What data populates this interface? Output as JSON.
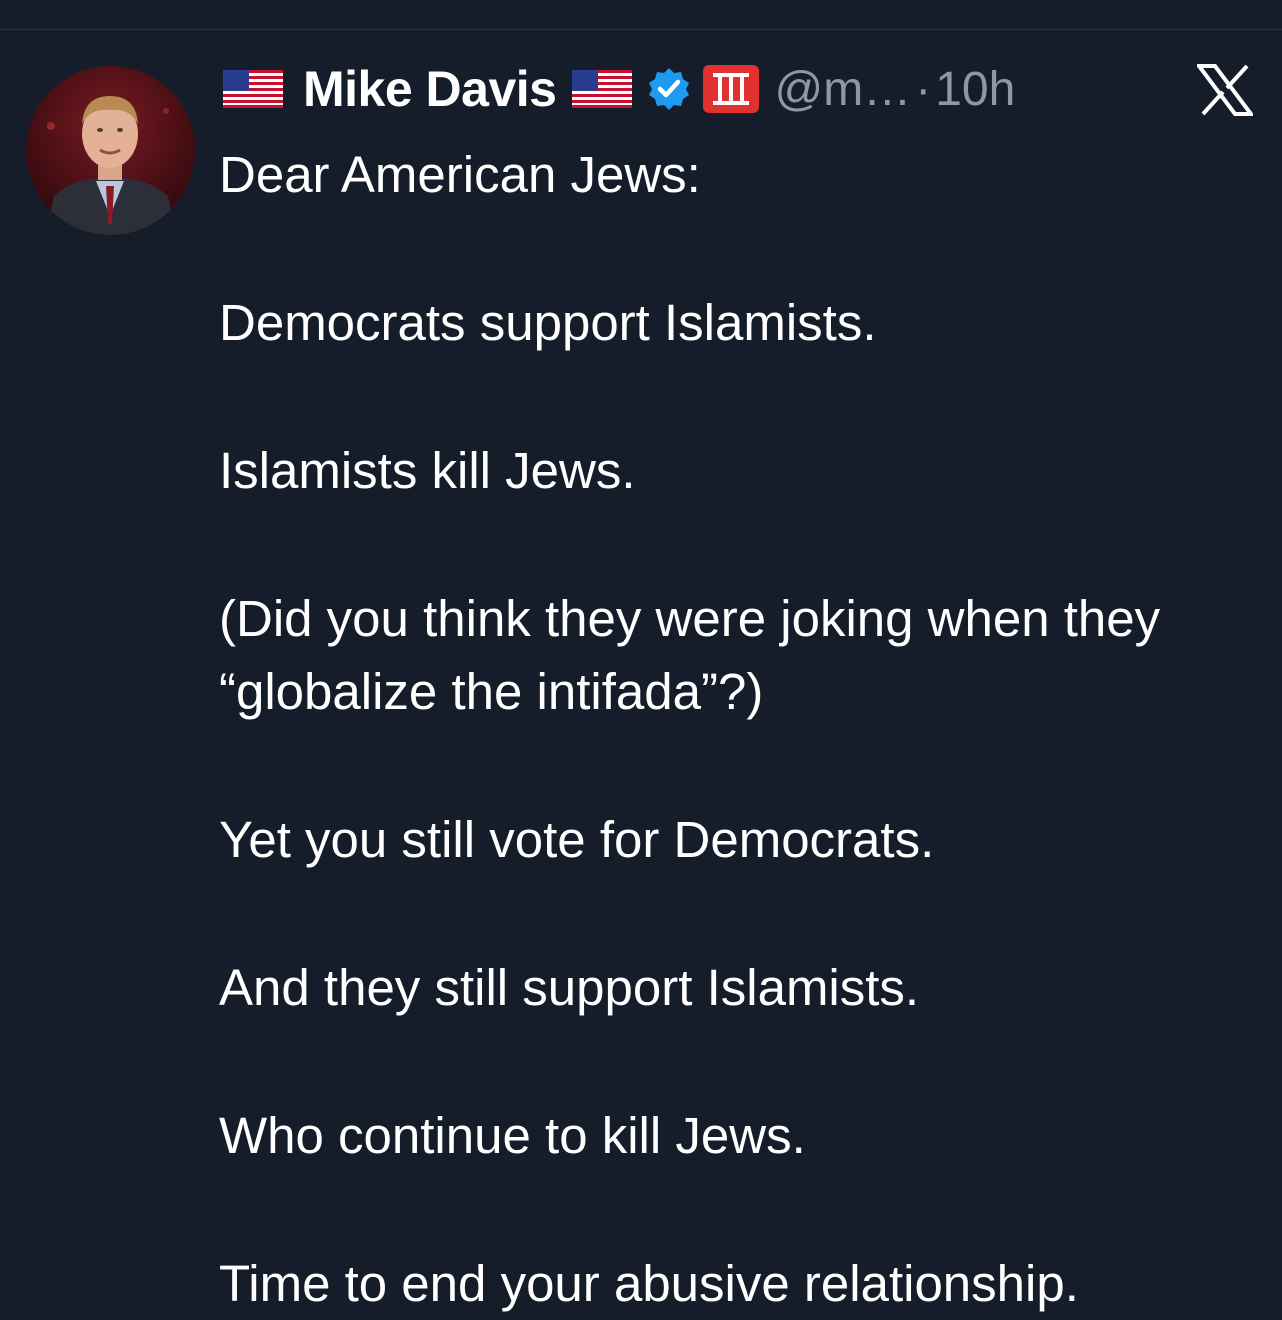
{
  "colors": {
    "background": "#151d2b",
    "text_primary": "#ffffff",
    "text_secondary": "#8b98a5",
    "verified_blue": "#1d9bf0",
    "badge_red": "#e0312f"
  },
  "tweet": {
    "author": {
      "flag_left": "us-flag-icon",
      "display_name": "Mike Davis",
      "flag_right": "us-flag-icon",
      "verified_icon": "verified-badge-icon",
      "affiliate_badge": "roman-numeral-three-icon",
      "handle": "@m…",
      "separator": "·",
      "timestamp": "10h",
      "avatar_icon": "avatar-photo"
    },
    "platform_logo": "x-logo-icon",
    "paragraphs": [
      "Dear American Jews:",
      "Democrats support Islamists.",
      "Islamists kill Jews.",
      "(Did you think they were joking when they “globalize the intifada”?)",
      "Yet you still vote for Democrats.",
      "And they still support Islamists.",
      "Who continue to kill Jews.",
      "Time to end your abusive relationship."
    ]
  }
}
